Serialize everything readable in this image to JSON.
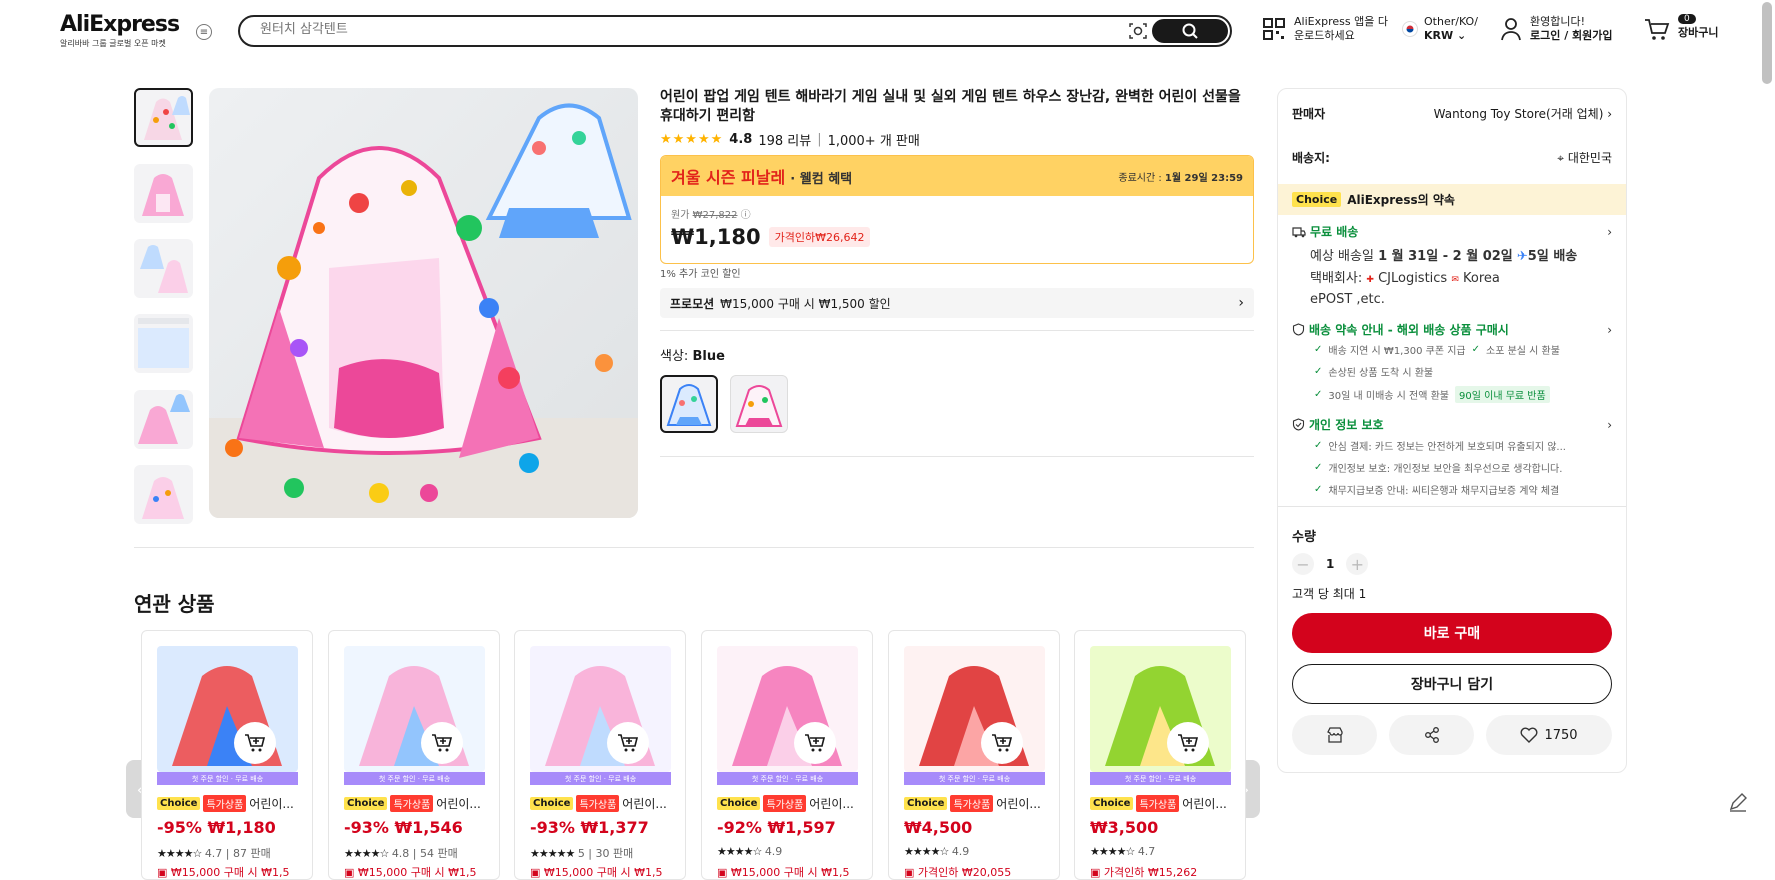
{
  "header": {
    "logo_text": "AliExpress",
    "logo_sub": "알리바바 그룹 글로벌 오픈 마켓",
    "search_placeholder": "원터치 삼각텐트",
    "app_line1": "AliExpress 앱을 다",
    "app_line2": "운로드하세요",
    "lang_line1": "Other/KO/",
    "lang_line2": "KRW",
    "account_line1": "환영합니다!",
    "account_line2": "로그인 / 회원가입",
    "cart_count": "0",
    "cart_label": "장바구니"
  },
  "product": {
    "title": "어린이 팝업 게임 텐트 해바라기 게임 실내 및 실외 게임 텐트 하우스 장난감, 완벽한 어린이 선물을 휴대하기 편리함",
    "stars": "★★★★★",
    "rating": "4.8",
    "reviews": "198 리뷰",
    "sold": "1,000+ 개 판매",
    "sale_title": "겨울 시즌 피날레",
    "sale_sub": "· 웰컴 혜택",
    "end_label": "종료시간 :",
    "end_time": "1월 29일 23:59",
    "orig_label": "원가",
    "orig_price": "₩27,822",
    "price": "₩1,180",
    "discount": "가격인하₩26,642",
    "coin": "1% 추가 코인 할인",
    "promo_label": "프로모션",
    "promo_text": "₩15,000 구매 시 ₩1,500 할인",
    "color_label": "색상:",
    "color_value": "Blue"
  },
  "panel": {
    "seller_label": "판매자",
    "seller_value": "Wantong Toy Store(거래 업체)",
    "ship_to_label": "배송지:",
    "ship_to_value": "대한민국",
    "choice_tag": "Choice",
    "choice_promise": "AliExpress의 약속",
    "free_ship": "무료 배송",
    "est_prefix": "예상 배송일",
    "est_dates": "1 월 31일 - 2 월 02일",
    "est_days": "5일 배송",
    "carrier_label": "택배회사:",
    "carrier_1": "CJLogistics",
    "carrier_2": "Korea",
    "carrier_3": "ePOST ,etc.",
    "promise_title": "배송 약속 안내 - 해외 배송 상품 구매시",
    "promise_1": "배송 지연 시 ₩1,300 쿠폰 지급",
    "promise_2": "소포 분실 시 환불",
    "promise_3": "손상된 상품 도착 시 환불",
    "promise_4": "30일 내 미배송 시 전액 환불",
    "promise_tag": "90일 이내 무료 반품",
    "privacy_title": "개인 정보 보호",
    "privacy_1": "안심 결제: 카드 정보는 안전하게 보호되며 유출되지 않...",
    "privacy_2": "개인정보 보호: 개인정보 보안을 최우선으로 생각합니다.",
    "privacy_3": "채무지급보증 안내: 씨티은행과 채무지급보증 계약 체결",
    "qty_label": "수량",
    "qty_value": "1",
    "qty_limit": "고객 당 최대 1",
    "buy_now": "바로 구매",
    "add_cart": "장바구니 담기",
    "wishlist_count": "1750"
  },
  "related": {
    "title": "연관 상품",
    "strip": "첫 주문 할인 · 무료 배송",
    "choice_tag": "Choice",
    "special_tag": "특가상품",
    "items": [
      {
        "name": "어린이...",
        "price": "-95% ₩1,180",
        "stars": "★★★★☆",
        "rating": "4.7",
        "sold": "87 판매",
        "promo": "₩15,000 구매 시 ₩1,5",
        "special": true
      },
      {
        "name": "어린이...",
        "price": "-93% ₩1,546",
        "stars": "★★★★☆",
        "rating": "4.8",
        "sold": "54 판매",
        "promo": "₩15,000 구매 시 ₩1,5",
        "special": true
      },
      {
        "name": "어린이...",
        "price": "-93% ₩1,377",
        "stars": "★★★★★",
        "rating": "5",
        "sold": "30 판매",
        "promo": "₩15,000 구매 시 ₩1,5",
        "special": true
      },
      {
        "name": "어린이...",
        "price": "-92% ₩1,597",
        "stars": "★★★★☆",
        "rating": "4.9",
        "sold": "",
        "promo": "₩15,000 구매 시 ₩1,5",
        "special": true
      },
      {
        "name": "어린이...",
        "price": "₩4,500",
        "stars": "★★★★☆",
        "rating": "4.9",
        "sold": "",
        "promo": "가격인하 ₩20,055",
        "special": true
      },
      {
        "name": "어린이...",
        "price": "₩3,500",
        "stars": "★★★★☆",
        "rating": "4.7",
        "sold": "",
        "promo": "가격인하 ₩15,262",
        "special": true
      }
    ]
  },
  "colors": {
    "accent_red": "#d3031c",
    "sale_yellow": "#ffd263",
    "choice_yellow": "#ffe24d",
    "green": "#0a8f3c",
    "strip_purple": "#a78bfa"
  }
}
